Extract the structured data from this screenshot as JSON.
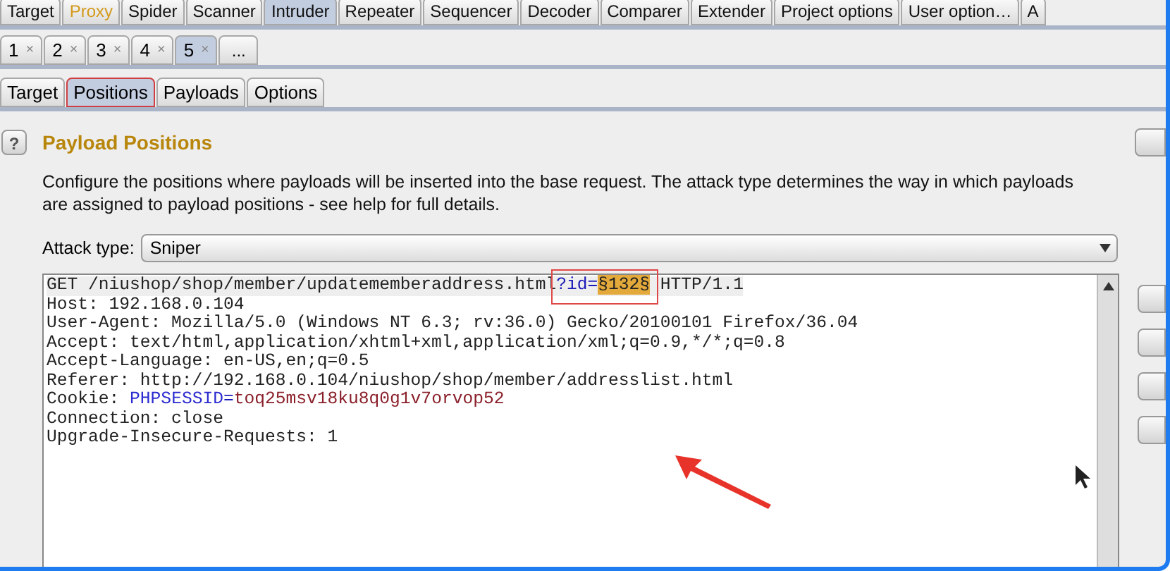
{
  "main_tabs": [
    {
      "label": "Target",
      "selected": false,
      "highlighted": false
    },
    {
      "label": "Proxy",
      "selected": false,
      "highlighted": true
    },
    {
      "label": "Spider",
      "selected": false,
      "highlighted": false
    },
    {
      "label": "Scanner",
      "selected": false,
      "highlighted": false
    },
    {
      "label": "Intruder",
      "selected": true,
      "highlighted": false
    },
    {
      "label": "Repeater",
      "selected": false,
      "highlighted": false
    },
    {
      "label": "Sequencer",
      "selected": false,
      "highlighted": false
    },
    {
      "label": "Decoder",
      "selected": false,
      "highlighted": false
    },
    {
      "label": "Comparer",
      "selected": false,
      "highlighted": false
    },
    {
      "label": "Extender",
      "selected": false,
      "highlighted": false
    },
    {
      "label": "Project options",
      "selected": false,
      "highlighted": false
    },
    {
      "label": "User option…",
      "selected": false,
      "highlighted": false
    },
    {
      "label": "A",
      "selected": false,
      "highlighted": false
    }
  ],
  "attack_tabs": [
    {
      "label": "1",
      "close": "×",
      "selected": false
    },
    {
      "label": "2",
      "close": "×",
      "selected": false
    },
    {
      "label": "3",
      "close": "×",
      "selected": false
    },
    {
      "label": "4",
      "close": "×",
      "selected": false
    },
    {
      "label": "5",
      "close": "×",
      "selected": true
    }
  ],
  "new_tab_button": "...",
  "sub_tabs": [
    {
      "label": "Target",
      "selected": false
    },
    {
      "label": "Positions",
      "selected": true
    },
    {
      "label": "Payloads",
      "selected": false
    },
    {
      "label": "Options",
      "selected": false
    }
  ],
  "help_button": "?",
  "section_title": "Payload Positions",
  "description": "Configure the positions where payloads will be inserted into the base request. The attack type determines the way in which payloads are assigned to payload positions - see help for full details.",
  "attack_type": {
    "label": "Attack type:",
    "value": "Sniper"
  },
  "request_lines": [
    [
      {
        "kind": "plain",
        "text": "GET /niushop/shop/member/updatememberaddress.html"
      },
      {
        "kind": "param",
        "text": "?id="
      },
      {
        "kind": "payload",
        "text": "§132§"
      },
      {
        "kind": "plain",
        "text": " HTTP/1.1"
      }
    ],
    [
      {
        "kind": "plain",
        "text": "Host: 192.168.0.104"
      }
    ],
    [
      {
        "kind": "plain",
        "text": "User-Agent: Mozilla/5.0 (Windows NT 6.3; rv:36.0) Gecko/20100101 Firefox/36.04"
      }
    ],
    [
      {
        "kind": "plain",
        "text": "Accept: text/html,application/xhtml+xml,application/xml;q=0.9,*/*;q=0.8"
      }
    ],
    [
      {
        "kind": "plain",
        "text": "Accept-Language: en-US,en;q=0.5"
      }
    ],
    [
      {
        "kind": "plain",
        "text": "Referer: http://192.168.0.104/niushop/shop/member/addresslist.html"
      }
    ],
    [
      {
        "kind": "plain",
        "text": "Cookie: "
      },
      {
        "kind": "cookie_name",
        "text": "PHPSESSID"
      },
      {
        "kind": "param",
        "text": "="
      },
      {
        "kind": "cookie_value",
        "text": "toq25msv18ku8q0g1v7orvop52"
      }
    ],
    [
      {
        "kind": "plain",
        "text": "Connection: close"
      }
    ],
    [
      {
        "kind": "plain",
        "text": "Upgrade-Insecure-Requests: 1"
      }
    ]
  ]
}
